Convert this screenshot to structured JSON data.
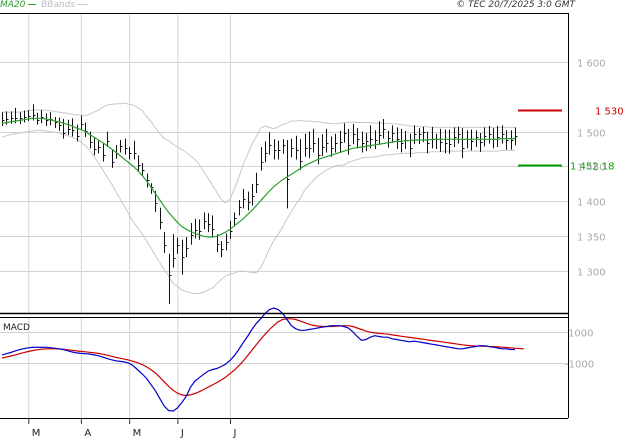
{
  "header": {
    "legend_ma": "MA20",
    "legend_bb": "BBands",
    "copyright": "© TEC 20/7/2025 3:0 GMT"
  },
  "colors": {
    "ma": "#2ca02c",
    "bands": "#c8c8c8",
    "price_bars": "#111111",
    "resistance": "#cc0000",
    "support": "#00a000",
    "macd": "#0000cc",
    "signal": "#cc0000",
    "grid": "#d4d4d4"
  },
  "chart_data": [
    {
      "type": "ohlc",
      "panel": "price",
      "y_ticks": [
        "1 300",
        "1 350",
        "1 400",
        "1 450",
        "1 500",
        "1 600"
      ],
      "ylim": [
        1240,
        1670
      ],
      "x_ticks": [
        "M",
        "A",
        "M",
        "J",
        "J"
      ],
      "levels": [
        {
          "name": "resistance",
          "label": "1 530 9",
          "value": 1530.9
        },
        {
          "name": "support",
          "label": "1 452 18",
          "value": 1452.18
        }
      ],
      "close": [
        1516,
        1518,
        1520,
        1520,
        1519,
        1521,
        1523,
        1524,
        1517,
        1521,
        1516,
        1518,
        1514,
        1510,
        1498,
        1504,
        1502,
        1494,
        1511,
        1501,
        1485,
        1475,
        1478,
        1466,
        1487,
        1457,
        1470,
        1480,
        1476,
        1469,
        1470,
        1452,
        1445,
        1430,
        1420,
        1397,
        1371,
        1338,
        1295,
        1319,
        1337,
        1320,
        1333,
        1352,
        1359,
        1357,
        1372,
        1368,
        1360,
        1339,
        1332,
        1342,
        1358,
        1376,
        1392,
        1403,
        1399,
        1407,
        1425,
        1456,
        1469,
        1481,
        1474,
        1473,
        1481,
        1432,
        1476,
        1474,
        1458,
        1477,
        1476,
        1484,
        1466,
        1478,
        1483,
        1477,
        1484,
        1485,
        1498,
        1481,
        1496,
        1490,
        1483,
        1486,
        1490,
        1488,
        1495,
        1504,
        1491,
        1498,
        1489,
        1484,
        1488,
        1477,
        1496,
        1496,
        1499,
        1483,
        1490,
        1489,
        1485,
        1483,
        1482,
        1492,
        1497,
        1476,
        1490,
        1487,
        1492,
        1485,
        1493,
        1497,
        1490,
        1492,
        1497,
        1488,
        1488,
        1494
      ],
      "high": [
        1528,
        1529,
        1529,
        1534,
        1528,
        1530,
        1531,
        1539,
        1527,
        1531,
        1526,
        1528,
        1521,
        1520,
        1518,
        1517,
        1519,
        1510,
        1523,
        1513,
        1500,
        1492,
        1487,
        1483,
        1500,
        1474,
        1481,
        1488,
        1490,
        1478,
        1487,
        1466,
        1455,
        1440,
        1426,
        1415,
        1391,
        1356,
        1325,
        1353,
        1348,
        1345,
        1349,
        1369,
        1375,
        1374,
        1384,
        1383,
        1380,
        1353,
        1343,
        1354,
        1372,
        1384,
        1402,
        1418,
        1414,
        1425,
        1441,
        1478,
        1486,
        1499,
        1489,
        1487,
        1489,
        1488,
        1490,
        1494,
        1489,
        1497,
        1500,
        1504,
        1491,
        1496,
        1504,
        1493,
        1497,
        1501,
        1512,
        1504,
        1511,
        1505,
        1500,
        1498,
        1509,
        1502,
        1515,
        1518,
        1501,
        1509,
        1506,
        1504,
        1501,
        1497,
        1509,
        1505,
        1507,
        1500,
        1507,
        1497,
        1504,
        1503,
        1503,
        1506,
        1507,
        1505,
        1502,
        1503,
        1502,
        1498,
        1506,
        1508,
        1505,
        1508,
        1509,
        1502,
        1502,
        1506
      ],
      "low": [
        1508,
        1510,
        1511,
        1512,
        1511,
        1513,
        1515,
        1516,
        1510,
        1512,
        1508,
        1509,
        1505,
        1501,
        1490,
        1495,
        1493,
        1486,
        1502,
        1492,
        1476,
        1466,
        1469,
        1457,
        1478,
        1448,
        1461,
        1470,
        1467,
        1460,
        1460,
        1443,
        1436,
        1420,
        1411,
        1385,
        1360,
        1326,
        1253,
        1305,
        1325,
        1295,
        1320,
        1338,
        1347,
        1345,
        1360,
        1356,
        1348,
        1327,
        1320,
        1330,
        1346,
        1364,
        1380,
        1390,
        1387,
        1394,
        1412,
        1444,
        1456,
        1467,
        1460,
        1460,
        1468,
        1390,
        1463,
        1460,
        1445,
        1464,
        1462,
        1470,
        1453,
        1465,
        1470,
        1464,
        1470,
        1471,
        1484,
        1467,
        1482,
        1476,
        1470,
        1472,
        1476,
        1475,
        1481,
        1490,
        1477,
        1484,
        1475,
        1470,
        1475,
        1463,
        1482,
        1482,
        1485,
        1469,
        1476,
        1475,
        1471,
        1469,
        1468,
        1478,
        1483,
        1462,
        1476,
        1473,
        1478,
        1471,
        1479,
        1483,
        1476,
        1478,
        1483,
        1474,
        1474,
        1480
      ],
      "ma20": [
        1512,
        1513,
        1514,
        1515,
        1516,
        1517,
        1518,
        1519,
        1519,
        1519,
        1518,
        1517,
        1515,
        1514,
        1512,
        1510,
        1508,
        1505,
        1503,
        1500,
        1496,
        1492,
        1488,
        1484,
        1480,
        1475,
        1470,
        1465,
        1460,
        1455,
        1450,
        1444,
        1437,
        1429,
        1420,
        1411,
        1402,
        1393,
        1384,
        1377,
        1370,
        1364,
        1360,
        1357,
        1354,
        1352,
        1350,
        1349,
        1349,
        1350,
        1353,
        1356,
        1360,
        1365,
        1370,
        1375,
        1381,
        1387,
        1394,
        1401,
        1408,
        1415,
        1421,
        1426,
        1431,
        1435,
        1439,
        1443,
        1447,
        1451,
        1454,
        1457,
        1460,
        1462,
        1464,
        1466,
        1468,
        1470,
        1472,
        1474,
        1476,
        1477,
        1478,
        1479,
        1480,
        1481,
        1482,
        1483,
        1484,
        1485,
        1486,
        1486,
        1487,
        1487,
        1488,
        1488,
        1488,
        1488,
        1489,
        1489,
        1489,
        1489,
        1489,
        1489,
        1489,
        1489,
        1489,
        1489,
        1489,
        1489,
        1489,
        1489,
        1489,
        1489,
        1490,
        1490,
        1490,
        1490
      ],
      "bb_upper": [
        1528,
        1528,
        1528,
        1528,
        1528,
        1529,
        1530,
        1531,
        1531,
        1531,
        1531,
        1530,
        1529,
        1528,
        1527,
        1526,
        1525,
        1524,
        1524,
        1523,
        1525,
        1528,
        1531,
        1535,
        1538,
        1539,
        1540,
        1540,
        1541,
        1539,
        1538,
        1534,
        1530,
        1522,
        1514,
        1505,
        1497,
        1490,
        1487,
        1482,
        1478,
        1474,
        1470,
        1465,
        1460,
        1453,
        1443,
        1433,
        1423,
        1413,
        1403,
        1398,
        1403,
        1418,
        1434,
        1453,
        1467,
        1482,
        1493,
        1505,
        1508,
        1506,
        1504,
        1507,
        1510,
        1512,
        1515,
        1515,
        1516,
        1515,
        1515,
        1514,
        1514,
        1513,
        1512,
        1512,
        1511,
        1512,
        1513,
        1513,
        1514,
        1513,
        1513,
        1513,
        1513,
        1512,
        1512,
        1512,
        1512,
        1511,
        1511,
        1510,
        1509,
        1508,
        1508,
        1507,
        1507,
        1507,
        1506,
        1506,
        1506,
        1506,
        1506,
        1506,
        1506,
        1506,
        1506,
        1506,
        1506,
        1506,
        1506,
        1506,
        1506,
        1506,
        1506,
        1506,
        1506,
        1506
      ],
      "bb_lower": [
        1492,
        1494,
        1496,
        1497,
        1498,
        1499,
        1500,
        1501,
        1502,
        1502,
        1501,
        1500,
        1499,
        1498,
        1496,
        1494,
        1492,
        1489,
        1485,
        1480,
        1473,
        1464,
        1455,
        1445,
        1435,
        1425,
        1414,
        1403,
        1392,
        1381,
        1370,
        1362,
        1353,
        1343,
        1333,
        1322,
        1312,
        1302,
        1293,
        1283,
        1278,
        1273,
        1271,
        1269,
        1268,
        1268,
        1270,
        1273,
        1276,
        1282,
        1288,
        1293,
        1296,
        1297,
        1300,
        1300,
        1299,
        1298,
        1298,
        1305,
        1318,
        1332,
        1344,
        1353,
        1363,
        1375,
        1385,
        1396,
        1404,
        1416,
        1423,
        1430,
        1436,
        1441,
        1445,
        1448,
        1451,
        1452,
        1452,
        1456,
        1458,
        1460,
        1462,
        1463,
        1463,
        1464,
        1465,
        1466,
        1467,
        1467,
        1468,
        1468,
        1469,
        1469,
        1469,
        1470,
        1470,
        1470,
        1471,
        1471,
        1471,
        1472,
        1472,
        1472,
        1472,
        1472,
        1472,
        1472,
        1472,
        1472,
        1472,
        1472,
        1472,
        1472,
        1473,
        1473,
        1473,
        1473
      ]
    },
    {
      "type": "line",
      "panel": "macd",
      "title": "MACD",
      "y_ticks": [
        "1000",
        "-1000"
      ],
      "ylim": [
        -4600,
        1900
      ],
      "series": [
        {
          "name": "macd",
          "values": [
            -500,
            -420,
            -340,
            -240,
            -160,
            -90,
            -40,
            -10,
            0,
            -10,
            0,
            -30,
            -60,
            -100,
            -160,
            -230,
            -310,
            -370,
            -400,
            -420,
            -440,
            -500,
            -560,
            -640,
            -740,
            -820,
            -880,
            -920,
            -960,
            -1040,
            -1220,
            -1480,
            -1740,
            -2040,
            -2440,
            -2840,
            -3340,
            -3820,
            -4120,
            -4150,
            -3950,
            -3600,
            -3200,
            -2600,
            -2200,
            -1980,
            -1750,
            -1550,
            -1450,
            -1380,
            -1250,
            -1100,
            -850,
            -550,
            -150,
            300,
            700,
            1150,
            1550,
            1850,
            2200,
            2450,
            2550,
            2450,
            2200,
            1800,
            1400,
            1200,
            1100,
            1100,
            1150,
            1200,
            1250,
            1300,
            1350,
            1400,
            1400,
            1400,
            1350,
            1250,
            1000,
            700,
            450,
            500,
            650,
            750,
            700,
            650,
            650,
            550,
            500,
            450,
            400,
            350,
            400,
            350,
            300,
            250,
            200,
            150,
            100,
            50,
            0,
            -50,
            -100,
            -100,
            -50,
            0,
            50,
            100,
            100,
            50,
            0,
            -50,
            -100,
            -100,
            -150,
            -150
          ]
        },
        {
          "name": "signal",
          "values": [
            -700,
            -640,
            -570,
            -500,
            -420,
            -350,
            -280,
            -220,
            -170,
            -130,
            -110,
            -100,
            -100,
            -110,
            -130,
            -160,
            -200,
            -240,
            -270,
            -300,
            -330,
            -360,
            -400,
            -450,
            -520,
            -590,
            -660,
            -720,
            -780,
            -840,
            -920,
            -1010,
            -1130,
            -1280,
            -1460,
            -1680,
            -1950,
            -2250,
            -2540,
            -2790,
            -2980,
            -3100,
            -3140,
            -3100,
            -3010,
            -2890,
            -2750,
            -2600,
            -2450,
            -2300,
            -2130,
            -1940,
            -1720,
            -1480,
            -1210,
            -900,
            -550,
            -190,
            170,
            510,
            850,
            1150,
            1420,
            1650,
            1800,
            1850,
            1850,
            1800,
            1700,
            1600,
            1500,
            1420,
            1380,
            1360,
            1350,
            1350,
            1360,
            1380,
            1400,
            1400,
            1350,
            1250,
            1150,
            1050,
            980,
            930,
            900,
            880,
            850,
            800,
            760,
            720,
            680,
            640,
            600,
            560,
            520,
            480,
            440,
            400,
            360,
            320,
            280,
            240,
            200,
            160,
            120,
            100,
            80,
            70,
            60,
            50,
            40,
            20,
            0,
            -20,
            -40,
            -60,
            -80,
            -100
          ]
        }
      ]
    }
  ]
}
